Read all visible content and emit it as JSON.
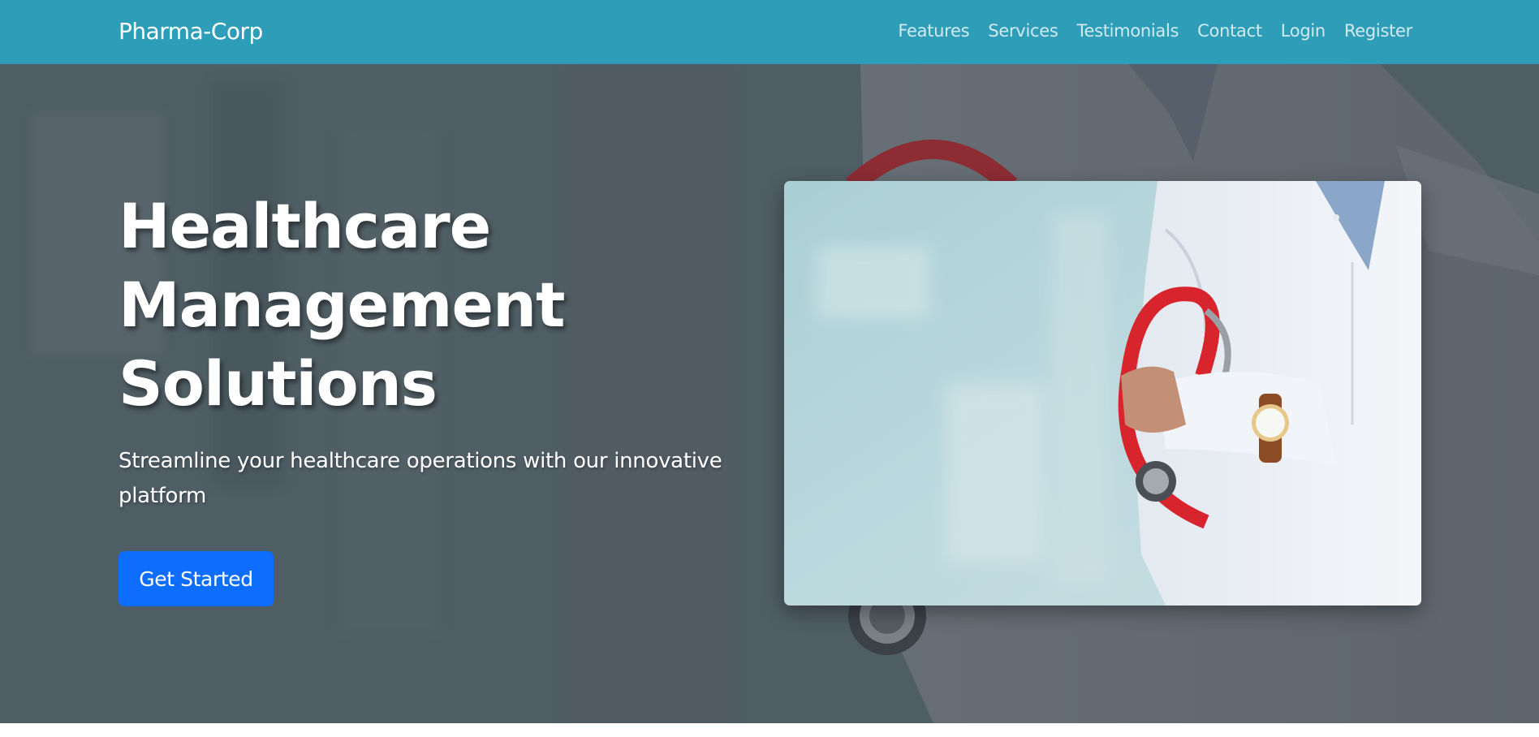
{
  "navbar": {
    "brand": "Pharma-Corp",
    "links": [
      "Features",
      "Services",
      "Testimonials",
      "Contact",
      "Login",
      "Register"
    ],
    "background": "#2e9db8"
  },
  "hero": {
    "title_lines": [
      "Healthcare",
      "Management",
      "Solutions"
    ],
    "subtitle": "Streamline your healthcare operations with our innovative platform",
    "cta_label": "Get Started",
    "cta_color": "#0d6efd",
    "image_subject": "doctor-with-stethoscope-photo"
  }
}
